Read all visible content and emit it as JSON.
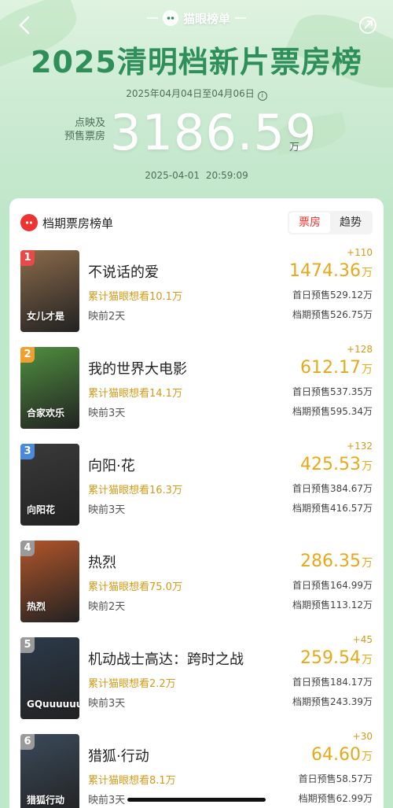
{
  "header": {
    "brand": "猫眼榜单",
    "title": "2025清明档新片票房榜",
    "date_range": "2025年04月04日至04月06日",
    "total_label_line1": "点映及",
    "total_label_line2": "预售票房",
    "total_value": "3186.59",
    "total_unit": "万",
    "timestamp": "2025-04-01  20:59:09"
  },
  "card": {
    "title": "档期票房榜单",
    "tabs": [
      {
        "label": "票房",
        "active": true
      },
      {
        "label": "趋势",
        "active": false
      }
    ]
  },
  "movies": [
    {
      "rank": "1",
      "name": "不说话的爱",
      "wish": "累计猫眼想看10.1万",
      "days": "映前2天",
      "delta": "+110",
      "gross": "1474.36",
      "unit": "万",
      "first_day": "首日预售529.12万",
      "period": "档期预售526.75万",
      "poster_text": "女儿才是",
      "rank_color": "#e84a4a",
      "poster_color": "#8a6a4a"
    },
    {
      "rank": "2",
      "name": "我的世界大电影",
      "wish": "累计猫眼想看14.1万",
      "days": "映前3天",
      "delta": "+128",
      "gross": "612.17",
      "unit": "万",
      "first_day": "首日预售537.35万",
      "period": "档期预售595.34万",
      "poster_text": "合家欢乐",
      "rank_color": "#f0a030",
      "poster_color": "#4f8f3f"
    },
    {
      "rank": "3",
      "name": "向阳·花",
      "wish": "累计猫眼想看16.3万",
      "days": "映前3天",
      "delta": "+132",
      "gross": "425.53",
      "unit": "万",
      "first_day": "首日预售384.67万",
      "period": "档期预售416.57万",
      "poster_text": "向阳花",
      "rank_color": "#4a8ad8",
      "poster_color": "#3a3a3a"
    },
    {
      "rank": "4",
      "name": "热烈",
      "wish": "累计猫眼想看75.0万",
      "days": "映前2天",
      "delta": "",
      "gross": "286.35",
      "unit": "万",
      "first_day": "首日预售164.99万",
      "period": "档期预售113.12万",
      "poster_text": "热烈",
      "rank_color": "#9a9a9a",
      "poster_color": "#b2552a"
    },
    {
      "rank": "5",
      "name": "机动战士高达：跨时之战",
      "wish": "累计猫眼想看2.2万",
      "days": "映前3天",
      "delta": "+45",
      "gross": "259.54",
      "unit": "万",
      "first_day": "首日预售184.17万",
      "period": "档期预售243.39万",
      "poster_text": "GQuuuuuuX",
      "rank_color": "#9a9a9a",
      "poster_color": "#2b3a4a"
    },
    {
      "rank": "6",
      "name": "猎狐·行动",
      "wish": "累计猫眼想看8.1万",
      "days": "映前3天",
      "delta": "+30",
      "gross": "64.60",
      "unit": "万",
      "first_day": "首日预售58.57万",
      "period": "档期预售62.99万",
      "poster_text": "猎狐行动",
      "rank_color": "#9a9a9a",
      "poster_color": "#3a4a5a"
    }
  ]
}
